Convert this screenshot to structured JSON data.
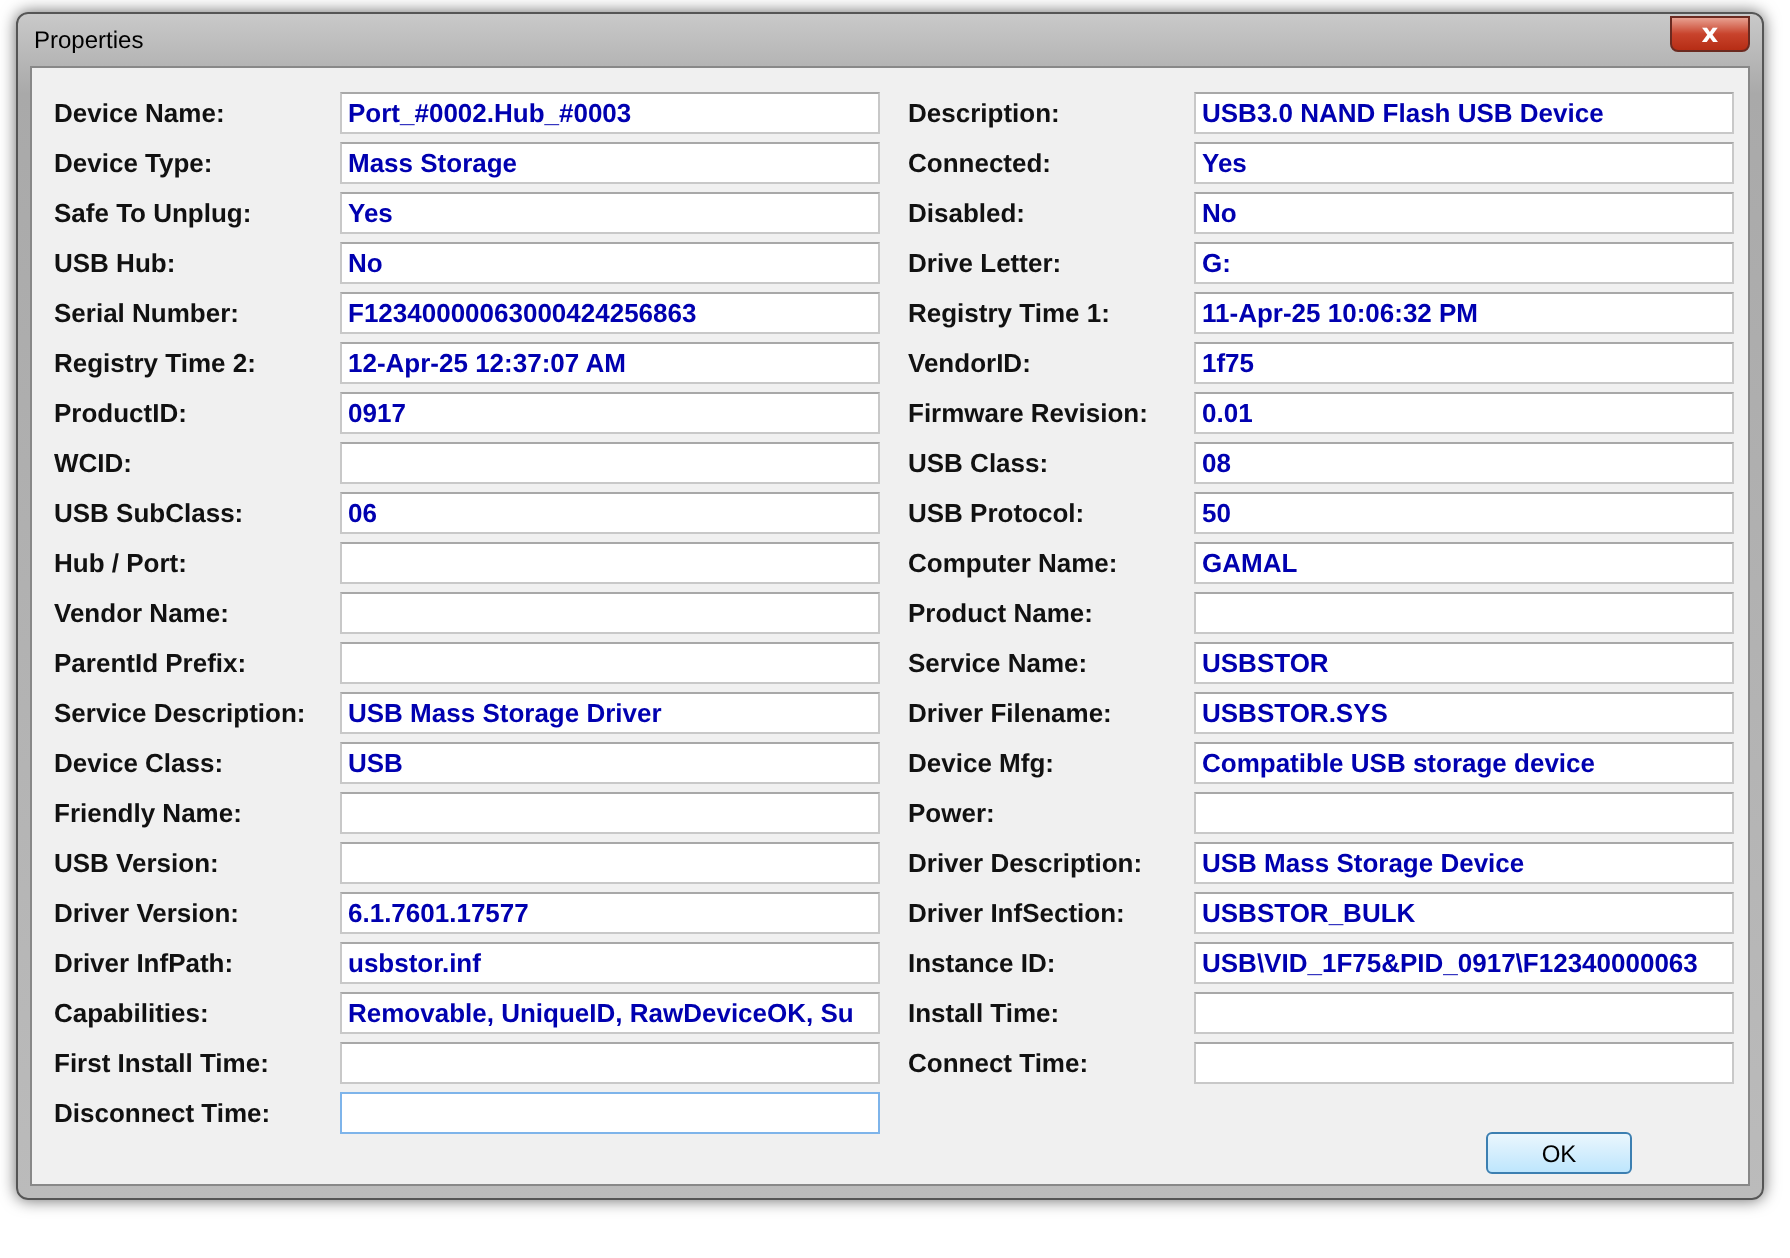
{
  "window": {
    "title": "Properties",
    "close": "x"
  },
  "left": [
    {
      "label": "Device Name:",
      "value": "Port_#0002.Hub_#0003",
      "focused": false
    },
    {
      "label": "Device Type:",
      "value": "Mass Storage",
      "focused": false
    },
    {
      "label": "Safe To Unplug:",
      "value": "Yes",
      "focused": false
    },
    {
      "label": "USB Hub:",
      "value": "No",
      "focused": false
    },
    {
      "label": "Serial Number:",
      "value": "F12340000063000424256863",
      "focused": false
    },
    {
      "label": "Registry Time 2:",
      "value": "12-Apr-25 12:37:07 AM",
      "focused": false
    },
    {
      "label": "ProductID:",
      "value": "0917",
      "focused": false
    },
    {
      "label": "WCID:",
      "focused": false
    },
    {
      "label": "USB SubClass:",
      "value": "06",
      "focused": false
    },
    {
      "label": "Hub / Port:",
      "focused": false
    },
    {
      "label": "Vendor Name:",
      "focused": false
    },
    {
      "label": "ParentId Prefix:",
      "focused": false
    },
    {
      "label": "Service Description:",
      "value": "USB Mass Storage Driver",
      "focused": false
    },
    {
      "label": "Device Class:",
      "value": "USB",
      "focused": false
    },
    {
      "label": "Friendly Name:",
      "focused": false
    },
    {
      "label": "USB Version:",
      "focused": false
    },
    {
      "label": "Driver Version:",
      "value": "6.1.7601.17577",
      "focused": false
    },
    {
      "label": "Driver InfPath:",
      "value": "usbstor.inf",
      "focused": false
    },
    {
      "label": "Capabilities:",
      "value": "Removable, UniqueID, RawDeviceOK, Su",
      "focused": false
    },
    {
      "label": "First Install Time:",
      "focused": false
    },
    {
      "label": "Disconnect Time:",
      "focused": true
    }
  ],
  "right": [
    {
      "label": "Description:",
      "value": "USB3.0 NAND Flash USB Device",
      "focused": false
    },
    {
      "label": "Connected:",
      "value": "Yes",
      "focused": false
    },
    {
      "label": "Disabled:",
      "value": "No",
      "focused": false
    },
    {
      "label": "Drive Letter:",
      "value": "G:",
      "focused": false
    },
    {
      "label": "Registry Time 1:",
      "value": "11-Apr-25 10:06:32 PM",
      "focused": false
    },
    {
      "label": "VendorID:",
      "value": "1f75",
      "focused": false
    },
    {
      "label": "Firmware Revision:",
      "value": "0.01",
      "focused": false
    },
    {
      "label": "USB Class:",
      "value": "08",
      "focused": false
    },
    {
      "label": "USB Protocol:",
      "value": "50",
      "focused": false
    },
    {
      "label": "Computer Name:",
      "value": "GAMAL",
      "focused": false
    },
    {
      "label": "Product Name:",
      "focused": false
    },
    {
      "label": "Service Name:",
      "value": "USBSTOR",
      "focused": false
    },
    {
      "label": "Driver Filename:",
      "value": "USBSTOR.SYS",
      "focused": false
    },
    {
      "label": "Device Mfg:",
      "value": "Compatible USB storage device",
      "focused": false
    },
    {
      "label": "Power:",
      "focused": false
    },
    {
      "label": "Driver Description:",
      "value": "USB Mass Storage Device",
      "focused": false
    },
    {
      "label": "Driver InfSection:",
      "value": "USBSTOR_BULK",
      "focused": false
    },
    {
      "label": "Instance ID:",
      "value": "USB\\VID_1F75&PID_0917\\F12340000063",
      "focused": false
    },
    {
      "label": "Install Time:",
      "focused": false
    },
    {
      "label": "Connect Time:",
      "focused": false
    }
  ],
  "buttons": [
    "OK"
  ]
}
